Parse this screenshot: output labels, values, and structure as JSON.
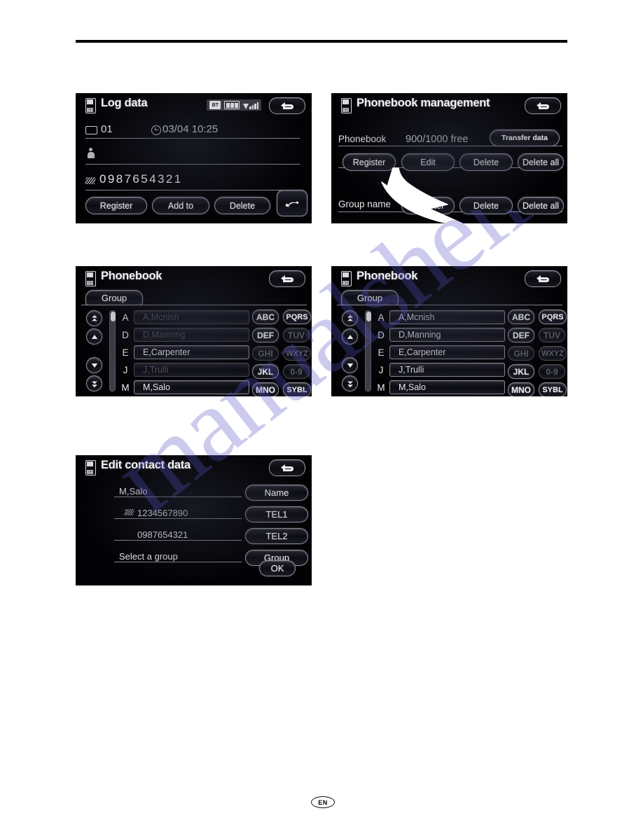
{
  "footer": {
    "language_badge": "EN"
  },
  "watermark": {
    "text": "manualshelf.com"
  },
  "panels": {
    "log_data": {
      "title": "Log data",
      "phone_icon": "phone-icon",
      "status": {
        "bluetooth": "BT",
        "battery_bars": 3,
        "signal_bars": 4
      },
      "back_icon": "back-arrow-icon",
      "rows": {
        "entry_number": "01",
        "entry_icon": "call-log-icon",
        "timestamp": "03/04 10:25",
        "clock_icon": "clock-icon",
        "name_icon": "person-icon",
        "name": "",
        "tel_icon": "telephone-icon",
        "number": "0987654321"
      },
      "buttons": {
        "register": "Register",
        "add_to": "Add to",
        "delete": "Delete",
        "call_icon": "handset-icon"
      }
    },
    "phonebook_management": {
      "title": "Phonebook management",
      "back_icon": "back-arrow-icon",
      "phonebook_label": "Phonebook",
      "capacity": "900/1000 free",
      "transfer_data": "Transfer data",
      "actions": {
        "register": "Register",
        "edit": "Edit",
        "delete": "Delete",
        "delete_all": "Delete all"
      },
      "group_name_label": "Group name",
      "group_actions": {
        "register": "Register",
        "delete": "Delete",
        "delete_all": "Delete all"
      },
      "annotation": "arrow pointing to Edit"
    },
    "phonebook_left": {
      "title": "Phonebook",
      "back_icon": "back-arrow-icon",
      "group_tab": "Group",
      "nav": {
        "page_up": "page-up-icon",
        "up": "up-icon",
        "down": "down-icon",
        "page_down": "page-down-icon"
      },
      "entries": [
        {
          "letter": "A",
          "name": "A,Mcnish",
          "enabled": false
        },
        {
          "letter": "D",
          "name": "D,Manning",
          "enabled": false
        },
        {
          "letter": "E",
          "name": "E,Carpenter",
          "enabled": true
        },
        {
          "letter": "J",
          "name": "J,Trulli",
          "enabled": false
        },
        {
          "letter": "M",
          "name": "M,Salo",
          "enabled": true
        }
      ],
      "keypad": [
        {
          "label": "ABC",
          "enabled": true
        },
        {
          "label": "PQRS",
          "enabled": true
        },
        {
          "label": "DEF",
          "enabled": true
        },
        {
          "label": "TUV",
          "enabled": false
        },
        {
          "label": "GHI",
          "enabled": false
        },
        {
          "label": "WXYZ",
          "enabled": false
        },
        {
          "label": "JKL",
          "enabled": true
        },
        {
          "label": "0-9",
          "enabled": false
        },
        {
          "label": "MNO",
          "enabled": true
        },
        {
          "label": "SYBL",
          "enabled": true
        }
      ]
    },
    "phonebook_right": {
      "title": "Phonebook",
      "back_icon": "back-arrow-icon",
      "group_tab": "Group",
      "nav": {
        "page_up": "page-up-icon",
        "up": "up-icon",
        "down": "down-icon",
        "page_down": "page-down-icon"
      },
      "entries": [
        {
          "letter": "A",
          "name": "A,Mcnish",
          "enabled": true
        },
        {
          "letter": "D",
          "name": "D,Manning",
          "enabled": true
        },
        {
          "letter": "E",
          "name": "E,Carpenter",
          "enabled": true
        },
        {
          "letter": "J",
          "name": "J,Trulli",
          "enabled": true
        },
        {
          "letter": "M",
          "name": "M,Salo",
          "enabled": true
        }
      ],
      "keypad": [
        {
          "label": "ABC",
          "enabled": true
        },
        {
          "label": "PQRS",
          "enabled": true
        },
        {
          "label": "DEF",
          "enabled": true
        },
        {
          "label": "TUV",
          "enabled": false
        },
        {
          "label": "GHI",
          "enabled": false
        },
        {
          "label": "WXYZ",
          "enabled": false
        },
        {
          "label": "JKL",
          "enabled": true
        },
        {
          "label": "0-9",
          "enabled": false
        },
        {
          "label": "MNO",
          "enabled": true
        },
        {
          "label": "SYBL",
          "enabled": true
        }
      ]
    },
    "edit_contact": {
      "title": "Edit contact data",
      "back_icon": "back-arrow-icon",
      "fields": [
        {
          "value": "M,Salo",
          "button": "Name"
        },
        {
          "value": "1234567890",
          "button": "TEL1"
        },
        {
          "value": "0987654321",
          "button": "TEL2"
        },
        {
          "value": "Select a group",
          "button": "Group"
        }
      ],
      "ok_button": "OK"
    }
  }
}
